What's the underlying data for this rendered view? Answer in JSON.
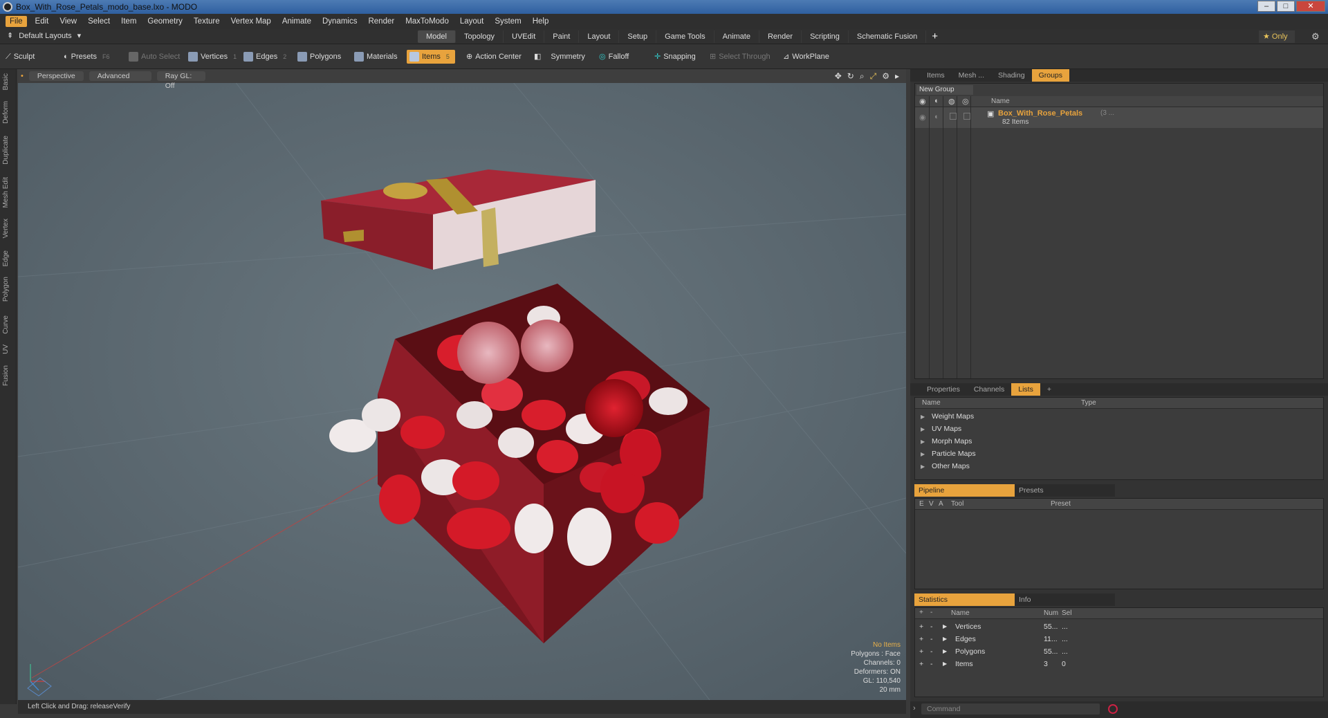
{
  "window": {
    "title": "Box_With_Rose_Petals_modo_base.lxo - MODO"
  },
  "menu": [
    "File",
    "Edit",
    "View",
    "Select",
    "Item",
    "Geometry",
    "Texture",
    "Vertex Map",
    "Animate",
    "Dynamics",
    "Render",
    "MaxToModo",
    "Layout",
    "System",
    "Help"
  ],
  "layouts": {
    "label": "Default Layouts",
    "tabs": [
      "Model",
      "Topology",
      "UVEdit",
      "Paint",
      "Layout",
      "Setup",
      "Game Tools",
      "Animate",
      "Render",
      "Scripting",
      "Schematic Fusion"
    ],
    "active": "Model",
    "only": "Only"
  },
  "toolbar": {
    "sculpt": "Sculpt",
    "presets": "Presets",
    "presets_key": "F6",
    "auto_select": "Auto Select",
    "vertices": "Vertices",
    "vertices_key": "1",
    "edges": "Edges",
    "edges_key": "2",
    "polygons": "Polygons",
    "materials": "Materials",
    "items": "Items",
    "items_key": "5",
    "action_center": "Action Center",
    "symmetry": "Symmetry",
    "falloff": "Falloff",
    "snapping": "Snapping",
    "select_through": "Select Through",
    "workplane": "WorkPlane"
  },
  "lefttabs": [
    "Basic",
    "Deform",
    "Duplicate",
    "Mesh Edit",
    "Vertex",
    "Edge",
    "Polygon",
    "Curve",
    "UV",
    "Fusion"
  ],
  "viewport": {
    "mode": "Perspective",
    "shading": "Advanced",
    "raygl": "Ray GL: Off",
    "info": {
      "items": "No Items",
      "polygons": "Polygons : Face",
      "channels": "Channels: 0",
      "deformers": "Deformers: ON",
      "gl": "GL: 110,540",
      "scale": "20 mm"
    }
  },
  "status": {
    "text": "Left Click and Drag:  releaseVerify"
  },
  "groups": {
    "tabs": [
      "Items",
      "Mesh ...",
      "Shading",
      "Groups"
    ],
    "active": "Groups",
    "new_group": "New Group",
    "col_name": "Name",
    "item_name": "Box_With_Rose_Petals",
    "item_suffix": "(3 ...",
    "item_count": "82 Items"
  },
  "lists": {
    "tabs": [
      "Properties",
      "Channels",
      "Lists"
    ],
    "active": "Lists",
    "col_name": "Name",
    "col_type": "Type",
    "rows": [
      "Weight Maps",
      "UV Maps",
      "Morph Maps",
      "Particle Maps",
      "Other Maps"
    ]
  },
  "pipeline": {
    "tab1": "Pipeline",
    "tab2": "Presets",
    "cols": [
      "E",
      "V",
      "A",
      "Tool",
      "Preset"
    ]
  },
  "statistics": {
    "tab1": "Statistics",
    "tab2": "Info",
    "col_name": "Name",
    "col_num": "Num",
    "col_sel": "Sel",
    "rows": [
      {
        "name": "Vertices",
        "num": "55...",
        "sel": "..."
      },
      {
        "name": "Edges",
        "num": "11...",
        "sel": "..."
      },
      {
        "name": "Polygons",
        "num": "55...",
        "sel": "..."
      },
      {
        "name": "Items",
        "num": "3",
        "sel": "0"
      }
    ]
  },
  "command": {
    "placeholder": "Command"
  }
}
